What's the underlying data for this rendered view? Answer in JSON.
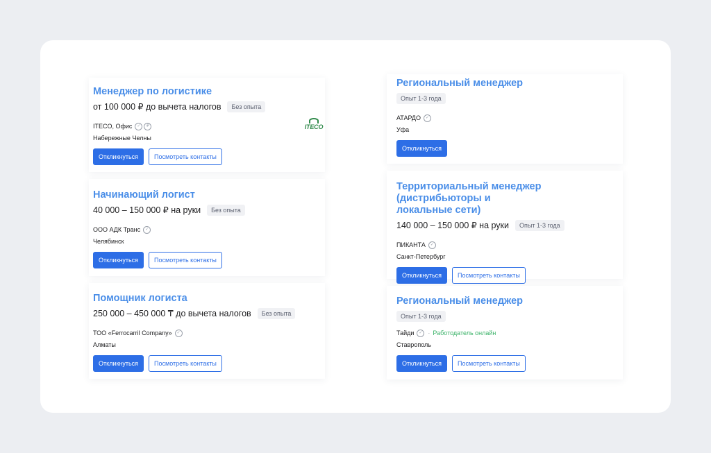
{
  "left_cards": [
    {
      "title": "Менеджер по логистике",
      "salary": "от 100 000 ₽ до вычета налогов",
      "experience": "Без опыта",
      "company": "ITECO, Офис",
      "city": "Набережные Челны",
      "logo_text": "ITECO",
      "respond_label": "Откликнуться",
      "contacts_label": "Посмотреть контакты"
    },
    {
      "title": "Начинающий логист",
      "salary": "40 000 – 150 000 ₽ на руки",
      "experience": "Без опыта",
      "company": "ООО АДК Транс",
      "city": "Челябинск",
      "respond_label": "Откликнуться",
      "contacts_label": "Посмотреть контакты"
    },
    {
      "title": "Помощник логиста",
      "salary": "250 000 – 450 000 ₸ до вычета налогов",
      "experience": "Без опыта",
      "company": "ТОО «Ferrocarril Company»",
      "city": "Алматы",
      "respond_label": "Откликнуться",
      "contacts_label": "Посмотреть контакты"
    }
  ],
  "right_cards": [
    {
      "title": "Региональный менеджер",
      "experience": "Опыт 1-3 года",
      "company": "АТАРДО",
      "city": "Уфа",
      "respond_label": "Откликнуться"
    },
    {
      "title_line1": "Территориальный менеджер (дистрибьюторы и",
      "title_line2": "локальные сети)",
      "salary": "140 000 – 150 000 ₽ на руки",
      "experience": "Опыт 1-3 года",
      "company": "ПИКАНТА",
      "city": "Санкт-Петербург",
      "respond_label": "Откликнуться",
      "contacts_label": "Посмотреть контакты"
    },
    {
      "title": "Региональный менеджер",
      "experience": "Опыт 1-3 года",
      "company": "Тайди",
      "online_status": "Работодатель онлайн",
      "city": "Ставрополь",
      "respond_label": "Откликнуться",
      "contacts_label": "Посмотреть контакты"
    }
  ],
  "colors": {
    "accent": "#2d6ee6",
    "title": "#4a8ee8",
    "online": "#3db36a",
    "background": "#eceef2"
  },
  "icons": [
    "verified-check-icon",
    "iteco-logo"
  ]
}
